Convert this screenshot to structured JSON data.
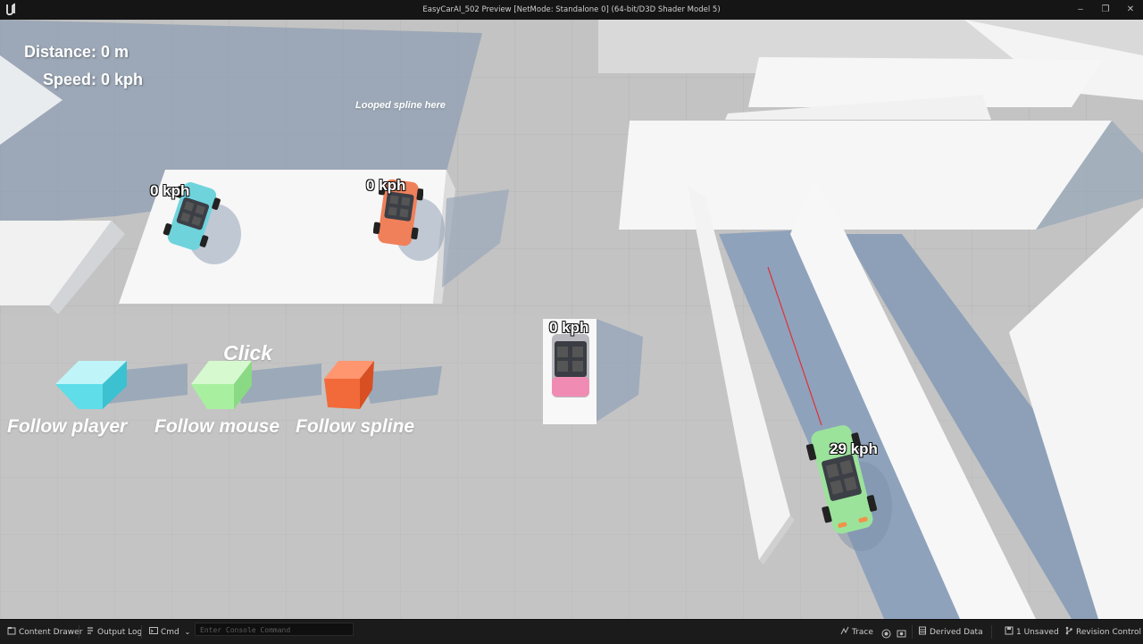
{
  "window": {
    "title": "EasyCarAI_502 Preview [NetMode: Standalone 0]  (64-bit/D3D Shader Model 5)",
    "minimize": "–",
    "maximize": "❐",
    "close": "✕"
  },
  "hud": {
    "distance": "Distance: 0 m",
    "speed": "Speed: 0 kph"
  },
  "world_text": {
    "spline_note": "Looped spline here",
    "click": "Click",
    "follow_player": "Follow player",
    "follow_mouse": "Follow mouse",
    "follow_spline": "Follow spline"
  },
  "cars": [
    {
      "speed": "0 kph",
      "color": "#6fd3dc"
    },
    {
      "speed": "0 kph",
      "color": "#f0805a"
    },
    {
      "speed": "0 kph",
      "color": "#f08cb4"
    },
    {
      "speed": "29 kph",
      "color": "#9be39b"
    }
  ],
  "cubes": [
    {
      "color": "#5fdde8",
      "icon": "cyan-cube"
    },
    {
      "color": "#a8f0a0",
      "icon": "green-cube"
    },
    {
      "color": "#f26a3a",
      "icon": "orange-cube"
    }
  ],
  "statusbar": {
    "content_drawer": "Content Drawer",
    "output_log": "Output Log",
    "cmd": "Cmd",
    "console_placeholder": "Enter Console Command",
    "trace": "Trace",
    "derived_data": "Derived Data",
    "unsaved": "1 Unsaved",
    "revision_control": "Revision Control"
  }
}
